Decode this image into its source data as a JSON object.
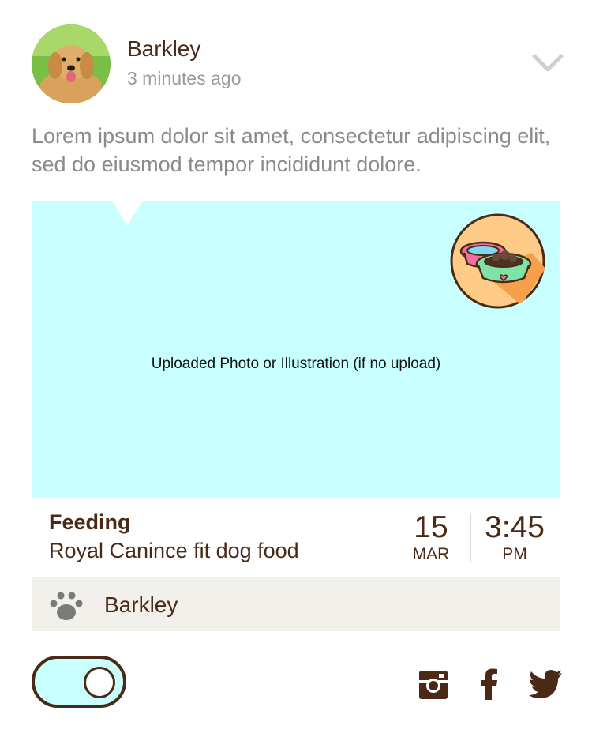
{
  "post": {
    "author": "Barkley",
    "timestamp": "3 minutes ago",
    "text": "Lorem ipsum dolor sit amet, consectetur adipiscing elit, sed do eiusmod tempor incididunt dolore.",
    "media_caption": "Uploaded Photo or Illustration (if no upload)"
  },
  "activity": {
    "type": "Feeding",
    "detail": "Royal Canince fit dog food",
    "day": "15",
    "month": "MAR",
    "time": "3:45",
    "ampm": "PM"
  },
  "pet": {
    "name": "Barkley"
  },
  "toggle": {
    "on": true
  },
  "icons": {
    "menu": "chevron-down-icon",
    "badge": "food-bowls-icon",
    "pet": "paw-icon",
    "social": [
      "instagram-icon",
      "facebook-icon",
      "twitter-icon"
    ]
  },
  "colors": {
    "brand_brown": "#4a2a17",
    "media_bg": "#c8ffff",
    "badge_bg": "#ffcc88",
    "pet_bar_bg": "#f2f0eb",
    "muted_text": "#8a8a8a"
  }
}
